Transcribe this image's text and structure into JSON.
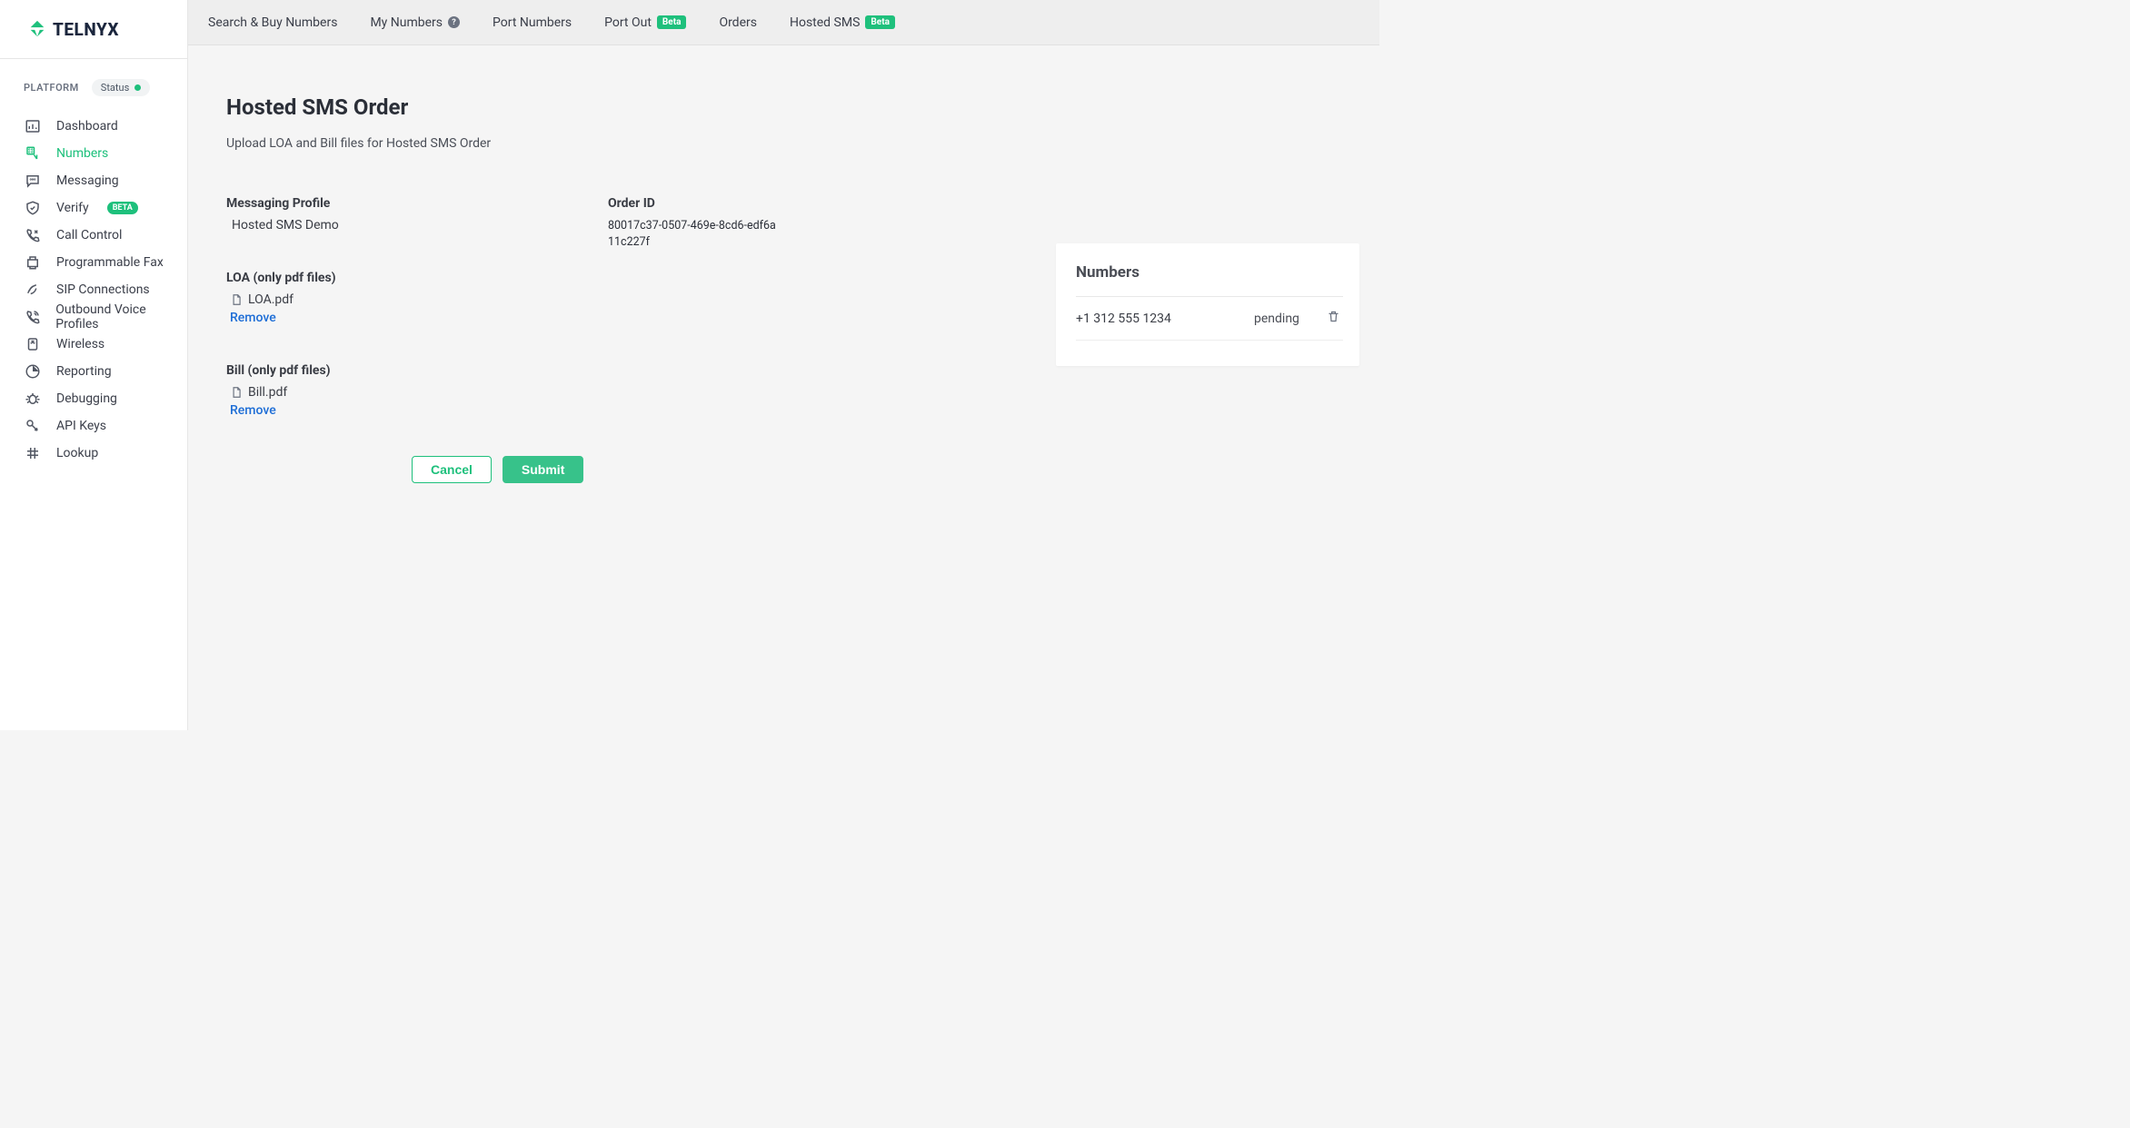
{
  "brand": {
    "name": "TELNYX"
  },
  "sidebar": {
    "section_label": "PLATFORM",
    "status_label": "Status",
    "items": [
      {
        "label": "Dashboard"
      },
      {
        "label": "Numbers"
      },
      {
        "label": "Messaging"
      },
      {
        "label": "Verify",
        "badge": "BETA"
      },
      {
        "label": "Call Control"
      },
      {
        "label": "Programmable Fax"
      },
      {
        "label": "SIP Connections"
      },
      {
        "label": "Outbound Voice Profiles"
      },
      {
        "label": "Wireless"
      },
      {
        "label": "Reporting"
      },
      {
        "label": "Debugging"
      },
      {
        "label": "API Keys"
      },
      {
        "label": "Lookup"
      }
    ]
  },
  "tabs": {
    "search_buy": "Search & Buy Numbers",
    "my_numbers": "My Numbers",
    "port_numbers": "Port Numbers",
    "port_out": "Port Out",
    "port_out_badge": "Beta",
    "orders": "Orders",
    "hosted_sms": "Hosted SMS",
    "hosted_sms_badge": "Beta"
  },
  "page": {
    "title": "Hosted SMS Order",
    "subtitle": "Upload LOA and Bill files for Hosted SMS Order"
  },
  "form": {
    "messaging_profile_label": "Messaging Profile",
    "messaging_profile_value": "Hosted SMS Demo",
    "order_id_label": "Order ID",
    "order_id_value": "80017c37-0507-469e-8cd6-edf6a11c227f",
    "loa_label": "LOA (only pdf files)",
    "loa_filename": "LOA.pdf",
    "loa_remove": "Remove",
    "bill_label": "Bill (only pdf files)",
    "bill_filename": "Bill.pdf",
    "bill_remove": "Remove"
  },
  "actions": {
    "cancel": "Cancel",
    "submit": "Submit"
  },
  "numbers_card": {
    "title": "Numbers",
    "rows": [
      {
        "phone": "+1 312 555 1234",
        "status": "pending"
      }
    ]
  }
}
